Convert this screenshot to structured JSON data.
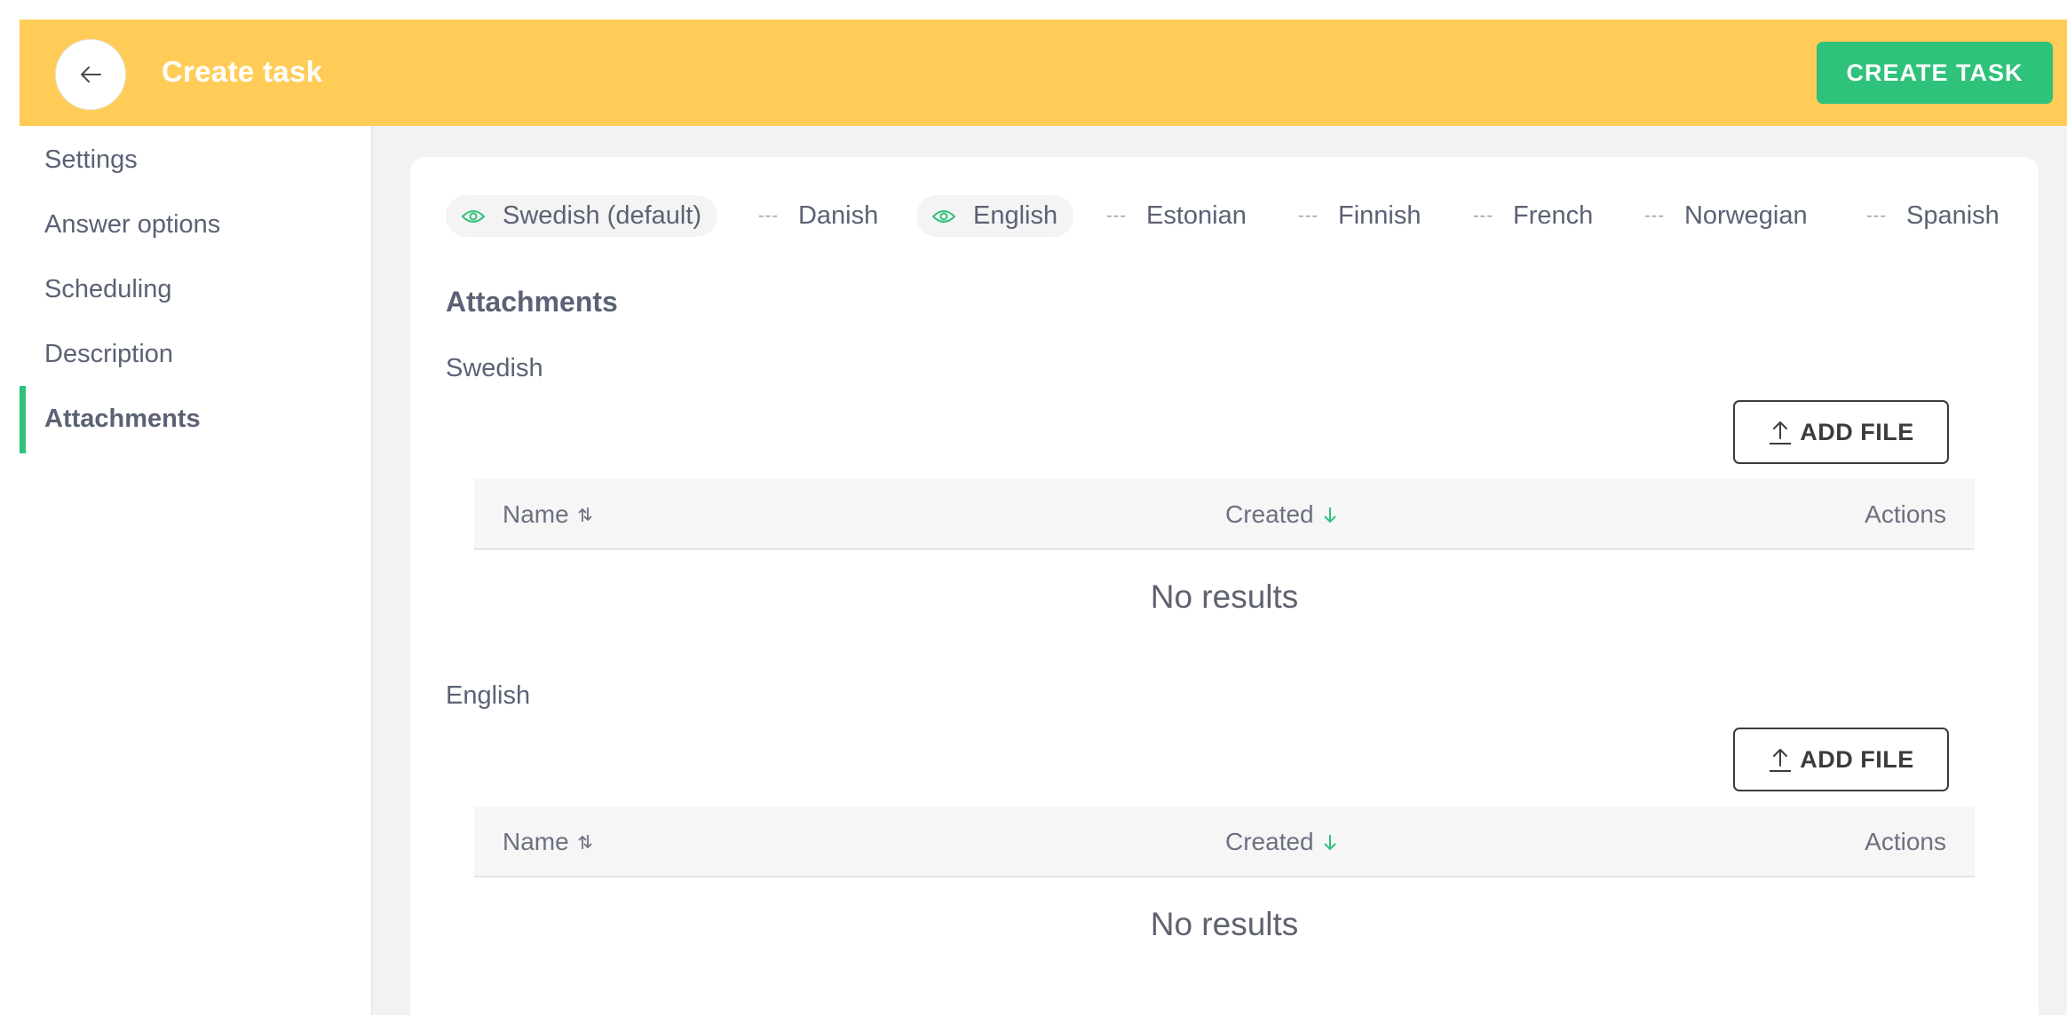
{
  "header": {
    "title": "Create task",
    "back_icon": "arrow-left-icon",
    "create_label": "CREATE TASK"
  },
  "sidebar": {
    "items": [
      {
        "label": "Settings"
      },
      {
        "label": "Answer options"
      },
      {
        "label": "Scheduling"
      },
      {
        "label": "Description"
      },
      {
        "label": "Attachments",
        "active": true
      }
    ]
  },
  "languages": [
    {
      "label": "Swedish (default)",
      "visible": true
    },
    {
      "label": "Danish",
      "visible": false
    },
    {
      "label": "English",
      "visible": true
    },
    {
      "label": "Estonian",
      "visible": false
    },
    {
      "label": "Finnish",
      "visible": false
    },
    {
      "label": "French",
      "visible": false
    },
    {
      "label": "Norwegian",
      "visible": false
    },
    {
      "label": "Spanish",
      "visible": false
    }
  ],
  "lang_dash": "---",
  "attachments": {
    "title": "Attachments",
    "add_file_label": "ADD FILE",
    "columns": {
      "name": "Name",
      "created": "Created",
      "actions": "Actions"
    },
    "no_results": "No results",
    "sections": [
      {
        "language": "Swedish"
      },
      {
        "language": "English"
      }
    ]
  },
  "colors": {
    "header_bg": "#ffcd57",
    "accent_green": "#2ec27a",
    "text": "#5b6275"
  }
}
